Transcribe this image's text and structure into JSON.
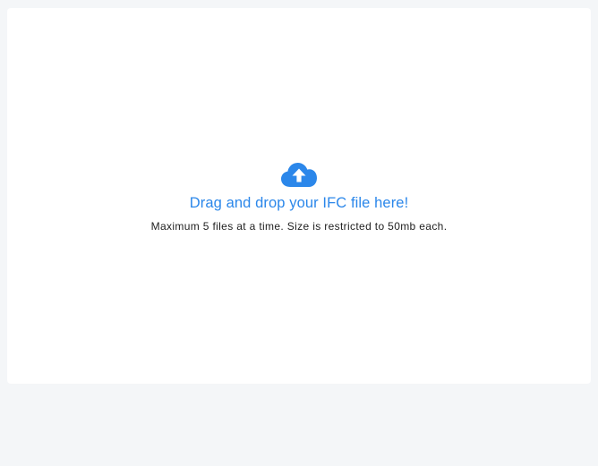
{
  "dropzone": {
    "icon": "cloud-upload-icon",
    "headline": "Drag and drop your IFC file here!",
    "subtext": "Maximum 5 files at a time. Size is restricted to 50mb each."
  },
  "colors": {
    "accent": "#2b87ea",
    "page_background": "#f4f6f8",
    "panel_background": "#ffffff",
    "subtext": "#222222"
  }
}
